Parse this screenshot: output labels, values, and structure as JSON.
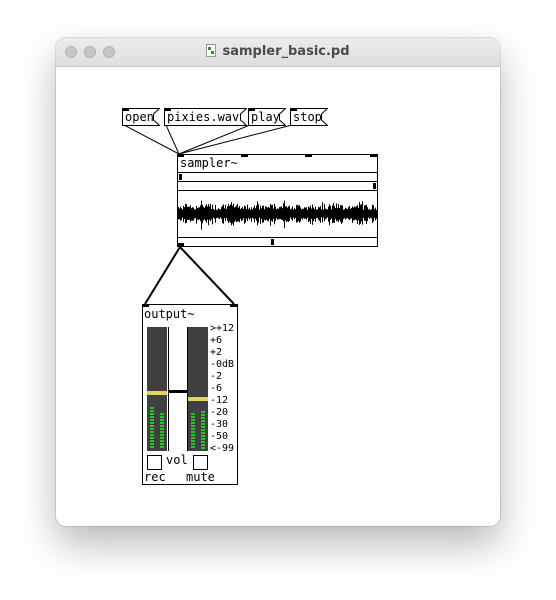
{
  "window": {
    "title": "sampler_basic.pd"
  },
  "messages": [
    {
      "label": "open"
    },
    {
      "label": "pixies.wav"
    },
    {
      "label": "play"
    },
    {
      "label": "stop"
    }
  ],
  "sampler": {
    "label": "sampler~"
  },
  "output": {
    "label": "output~",
    "db_scale": [
      ">+12",
      "+6",
      "+2",
      "-0dB",
      "-2",
      "-6",
      "-12",
      "-20",
      "-30",
      "-50",
      "<-99"
    ],
    "vol_label": "vol",
    "rec_label": "rec",
    "mute_label": "mute"
  }
}
